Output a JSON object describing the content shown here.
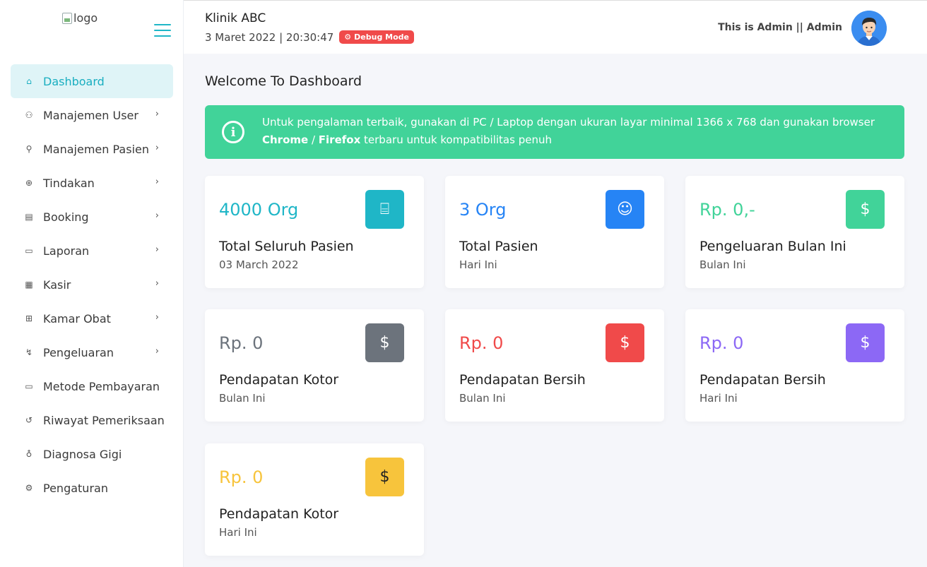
{
  "sidebar": {
    "logo_alt": "logo",
    "items": [
      {
        "label": "Dashboard",
        "icon": "home-icon",
        "glyph": "⌂",
        "has_chevron": false
      },
      {
        "label": "Manajemen User",
        "icon": "users-icon",
        "glyph": "⚇",
        "has_chevron": true
      },
      {
        "label": "Manajemen Pasien",
        "icon": "user-plus-icon",
        "glyph": "⚲",
        "has_chevron": true
      },
      {
        "label": "Tindakan",
        "icon": "plus-circle-icon",
        "glyph": "⊕",
        "has_chevron": true
      },
      {
        "label": "Booking",
        "icon": "book-icon",
        "glyph": "▤",
        "has_chevron": true
      },
      {
        "label": "Laporan",
        "icon": "clipboard-icon",
        "glyph": "▭",
        "has_chevron": true
      },
      {
        "label": "Kasir",
        "icon": "cash-register-icon",
        "glyph": "▦",
        "has_chevron": true
      },
      {
        "label": "Kamar Obat",
        "icon": "medicine-icon",
        "glyph": "⊞",
        "has_chevron": true
      },
      {
        "label": "Pengeluaran",
        "icon": "expense-icon",
        "glyph": "↯",
        "has_chevron": true
      },
      {
        "label": "Metode Pembayaran",
        "icon": "credit-card-icon",
        "glyph": "▭",
        "has_chevron": false
      },
      {
        "label": "Riwayat Pemeriksaan",
        "icon": "history-icon",
        "glyph": "↺",
        "has_chevron": false
      },
      {
        "label": "Diagnosa Gigi",
        "icon": "stethoscope-icon",
        "glyph": "♁",
        "has_chevron": false
      },
      {
        "label": "Pengaturan",
        "icon": "gear-icon",
        "glyph": "⚙",
        "has_chevron": false
      }
    ]
  },
  "header": {
    "clinic_name": "Klinik ABC",
    "datetime": "3 Maret 2022 | 20:30:47",
    "debug_label": "Debug Mode",
    "admin_text": "This is Admin || Admin"
  },
  "main": {
    "title": "Welcome To Dashboard",
    "alert": {
      "text_before": "Untuk pengalaman terbaik, gunakan di PC / Laptop dengan ukuran layar minimal 1366 x 768 dan gunakan browser ",
      "chrome": "Chrome",
      "separator": " / ",
      "firefox": "Firefox",
      "text_after": " terbaru untuk kompatibilitas penuh"
    },
    "cards": [
      {
        "value": "4000 Org",
        "title": "Total Seluruh Pasien",
        "sub": "03 March 2022",
        "color": "#1fb6c7",
        "icon_bg": "#1fb6c7",
        "icon": "bed-icon",
        "glyph": "⌸"
      },
      {
        "value": "3 Org",
        "title": "Total Pasien",
        "sub": "Hari Ini",
        "color": "#2684f5",
        "icon_bg": "#2684f5",
        "icon": "patient-icon",
        "glyph": "☺"
      },
      {
        "value": "Rp. 0,-",
        "title": "Pengeluaran Bulan Ini",
        "sub": "Bulan Ini",
        "color": "#41d399",
        "icon_bg": "#41d399",
        "icon": "dollar-icon",
        "glyph": "$"
      },
      {
        "value": "Rp. 0",
        "title": "Pendapatan Kotor",
        "sub": "Bulan Ini",
        "color": "#6c737c",
        "icon_bg": "#6c737c",
        "icon": "dollar-icon",
        "glyph": "$"
      },
      {
        "value": "Rp. 0",
        "title": "Pendapatan Bersih",
        "sub": "Bulan Ini",
        "color": "#f04a4a",
        "icon_bg": "#f04a4a",
        "icon": "dollar-icon",
        "glyph": "$"
      },
      {
        "value": "Rp. 0",
        "title": "Pendapatan Bersih",
        "sub": "Hari Ini",
        "color": "#8c68f5",
        "icon_bg": "#8c68f5",
        "icon": "dollar-icon",
        "glyph": "$"
      },
      {
        "value": "Rp. 0",
        "title": "Pendapatan Kotor",
        "sub": "Hari Ini",
        "color": "#f7c43c",
        "icon_bg": "#f7c43c",
        "icon": "dollar-icon",
        "glyph": "$",
        "icon_fg": "#222"
      }
    ]
  }
}
